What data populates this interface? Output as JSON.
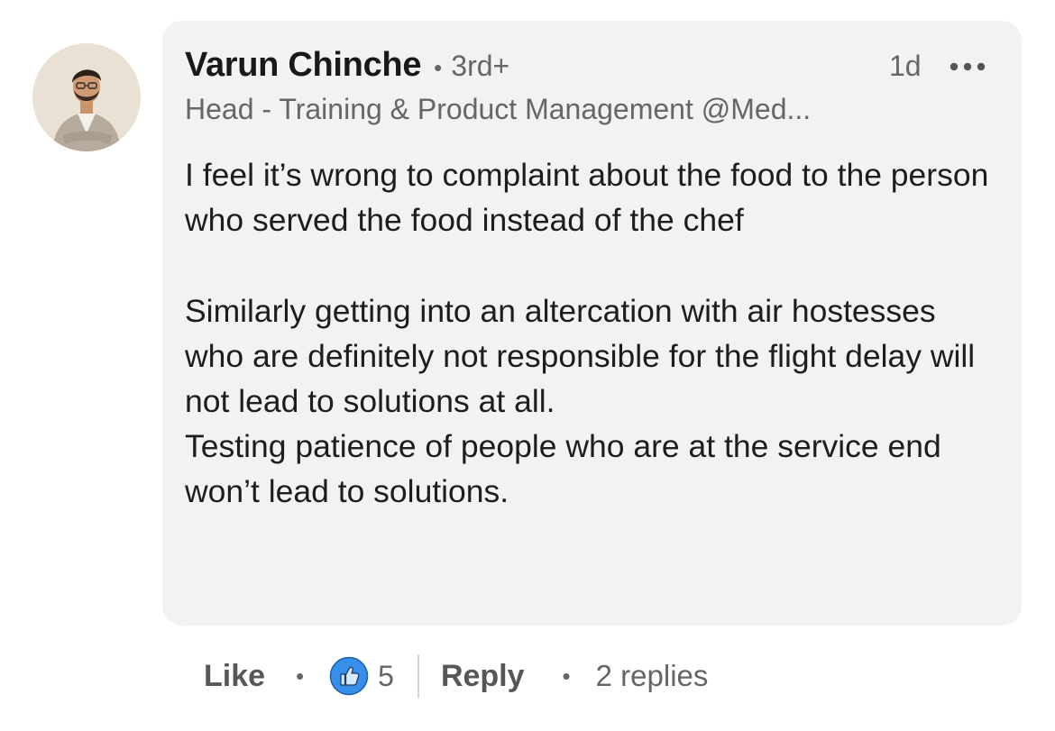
{
  "comment": {
    "author_name": "Varun Chinche",
    "connection_degree": "3rd+",
    "separator": "•",
    "headline": "Head - Training & Product Management @Med...",
    "timestamp": "1d",
    "more_icon": "more-horizontal-icon",
    "text": "I feel it’s wrong to complaint about the food to the person who served the food instead of the chef\n\nSimilarly getting into an altercation with air hostesses who are definitely not responsible for the flight delay will not lead to solutions at all.\nTesting patience of people who are at the service end won’t lead to solutions."
  },
  "actions": {
    "like_label": "Like",
    "separator": "•",
    "reaction_icon": "thumbs-up-icon",
    "reaction_count": "5",
    "reply_label": "Reply",
    "replies_label": "2 replies"
  },
  "colors": {
    "bubble_bg": "#f2f2f2",
    "like_blue": "#378fe9",
    "secondary_text": "#666666",
    "primary_text": "#191919"
  }
}
